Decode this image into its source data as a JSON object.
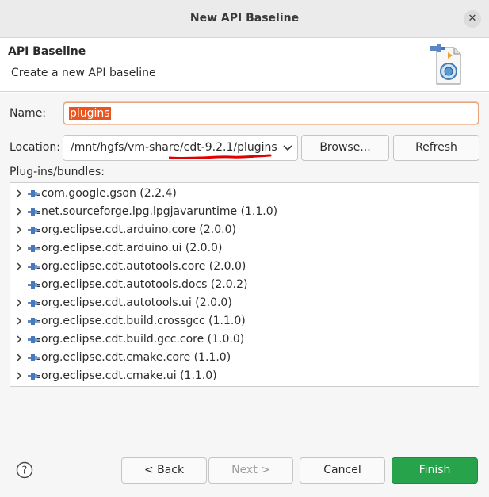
{
  "window": {
    "title": "New API Baseline"
  },
  "header": {
    "title": "API Baseline",
    "description": "Create a new API baseline"
  },
  "form": {
    "name_label": "Name:",
    "name_value": "plugins",
    "location_label": "Location:",
    "location_value": "/mnt/hgfs/vm-share/cdt-9.2.1/plugins",
    "browse_label": "Browse...",
    "refresh_label": "Refresh",
    "bundles_label": "Plug-ins/bundles:"
  },
  "bundles": [
    {
      "label": "com.google.gson (2.2.4)",
      "expandable": true
    },
    {
      "label": "net.sourceforge.lpg.lpgjavaruntime (1.1.0)",
      "expandable": true
    },
    {
      "label": "org.eclipse.cdt.arduino.core (2.0.0)",
      "expandable": true
    },
    {
      "label": "org.eclipse.cdt.arduino.ui (2.0.0)",
      "expandable": true
    },
    {
      "label": "org.eclipse.cdt.autotools.core (2.0.0)",
      "expandable": true
    },
    {
      "label": "org.eclipse.cdt.autotools.docs (2.0.2)",
      "expandable": false
    },
    {
      "label": "org.eclipse.cdt.autotools.ui (2.0.0)",
      "expandable": true
    },
    {
      "label": "org.eclipse.cdt.build.crossgcc (1.1.0)",
      "expandable": true
    },
    {
      "label": "org.eclipse.cdt.build.gcc.core (1.0.0)",
      "expandable": true
    },
    {
      "label": "org.eclipse.cdt.cmake.core (1.1.0)",
      "expandable": true
    },
    {
      "label": "org.eclipse.cdt.cmake.ui (1.1.0)",
      "expandable": true
    }
  ],
  "footer": {
    "back_label": "< Back",
    "next_label": "Next >",
    "cancel_label": "Cancel",
    "finish_label": "Finish"
  },
  "icons": {
    "close": "close-icon",
    "wizard": "api-baseline-wizard-icon",
    "dropdown": "chevron-down-icon",
    "expand": "chevron-right-icon",
    "plugin": "plugin-icon",
    "help": "help-icon"
  },
  "colors": {
    "accent": "#e95420",
    "finish_button": "#26a34b",
    "annotation_underline": "#e00000"
  }
}
